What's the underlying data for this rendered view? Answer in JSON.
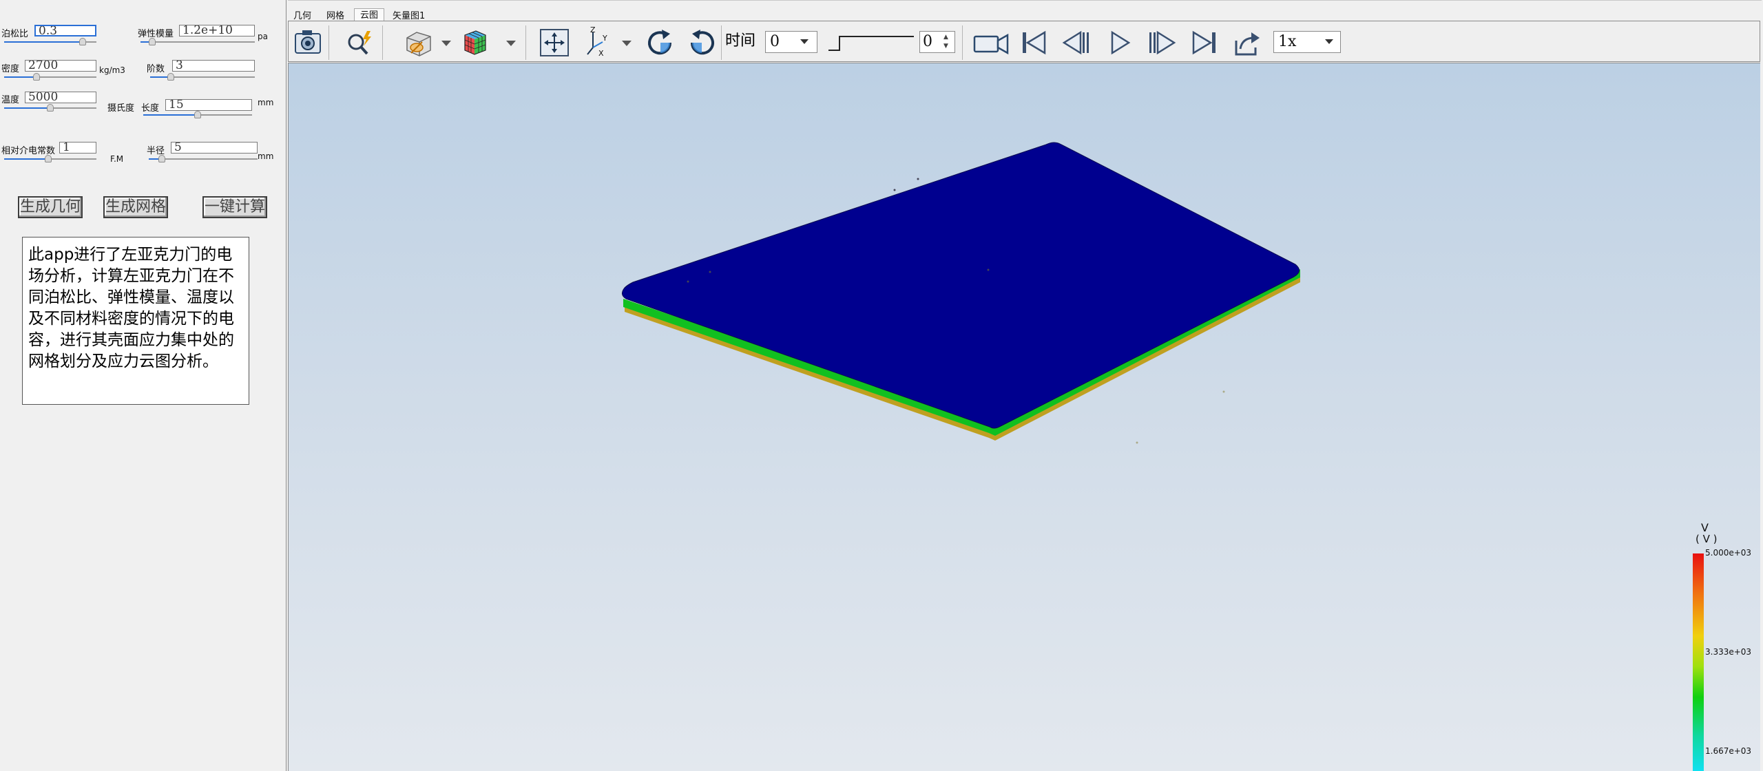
{
  "params": {
    "poisson": {
      "label": "泊松比",
      "value": "0.3",
      "slider": 0.85
    },
    "modulus": {
      "label": "弹性模量",
      "value": "1.2e+10",
      "unit": "pa",
      "slider": 0.1
    },
    "density": {
      "label": "密度",
      "value": "2700",
      "unit": "kg/m3",
      "slider": 0.35
    },
    "order": {
      "label": "阶数",
      "value": "3",
      "slider": 0.2
    },
    "temperature": {
      "label": "温度",
      "value": "5000",
      "slider": 0.5
    },
    "celsius_label": "摄氏度",
    "length": {
      "label": "长度",
      "value": "15",
      "unit": "mm",
      "slider": 0.5
    },
    "permittivity": {
      "label": "相对介电常数",
      "value": "1",
      "unit": "F.M",
      "slider": 0.48
    },
    "radius": {
      "label": "半径",
      "value": "5",
      "unit": "mm",
      "slider": 0.12
    }
  },
  "buttons": {
    "geometry": "生成几何",
    "mesh": "生成网格",
    "compute": "一键计算"
  },
  "description": "此app进行了左亚克力门的电场分析，计算左亚克力门在不同泊松比、弹性模量、温度以及不同材料密度的情况下的电容，进行其壳面应力集中处的网格划分及应力云图分析。",
  "tabs": [
    {
      "label": "几何",
      "active": false
    },
    {
      "label": "网格",
      "active": false
    },
    {
      "label": "云图",
      "active": true
    },
    {
      "label": "矢量图1",
      "active": false
    }
  ],
  "toolbar": {
    "icons": [
      "camera-icon",
      "zoom-search-icon",
      "view-box-icon",
      "color-cube-icon",
      "fit-view-icon",
      "axis-orientation-icon",
      "rotate-clockwise-icon",
      "rotate-counterclockwise-icon",
      "video-camera-icon",
      "skip-first-icon",
      "step-back-icon",
      "play-icon",
      "step-forward-icon",
      "skip-last-icon",
      "export-icon"
    ],
    "time_label": "时间",
    "time_value": "0",
    "step_value": "0",
    "speed_value": "1x"
  },
  "legend": {
    "title": "V",
    "unit": "( V )",
    "ticks": [
      "5.000e+03",
      "3.333e+03",
      "1.667e+03"
    ],
    "colors": [
      "#e81010",
      "#f0d010",
      "#10d010",
      "#10e0f0"
    ]
  },
  "model": {
    "top_color": "#00008f",
    "edge_colors": [
      "#10c020",
      "#c0a020"
    ]
  }
}
